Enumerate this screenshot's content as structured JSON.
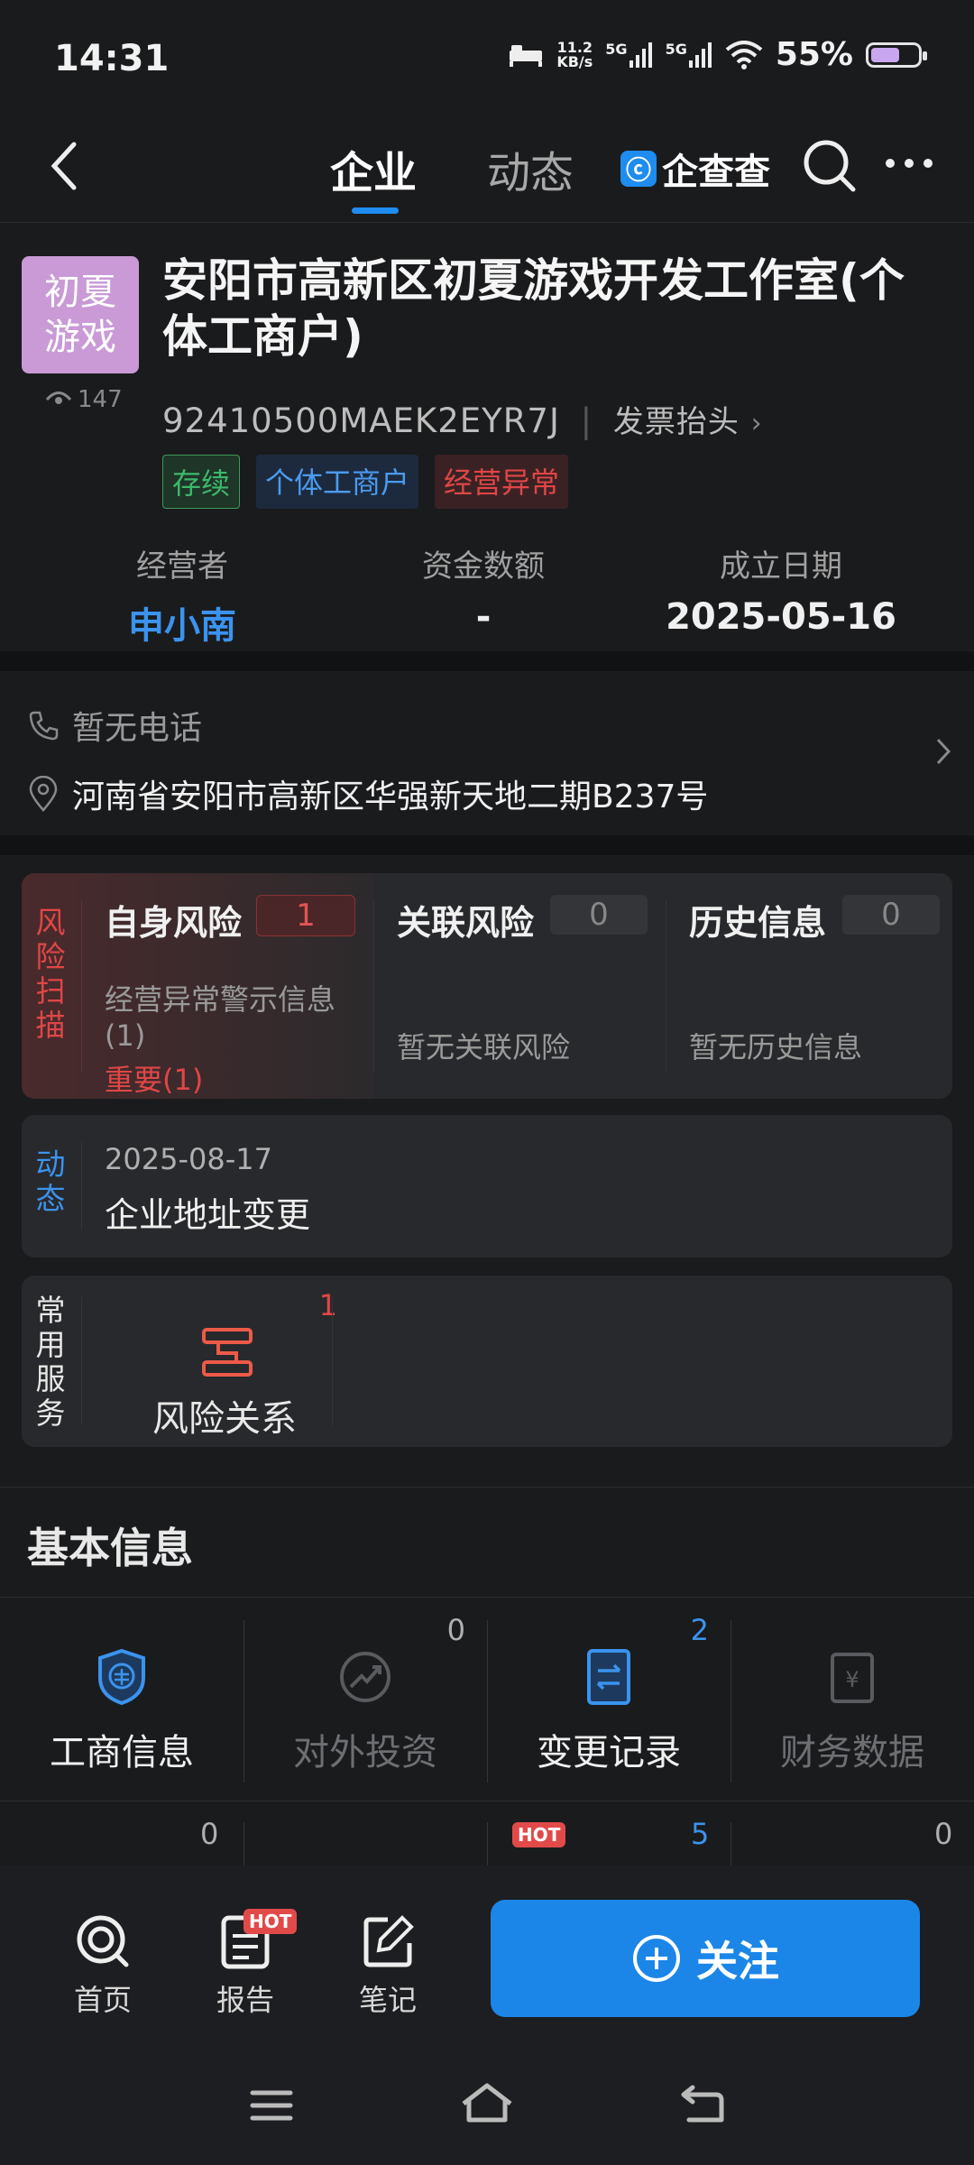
{
  "status_bar": {
    "time": "14:31",
    "net_speed_top": "11.2",
    "net_speed_bottom": "KB/s",
    "sig1": "5G",
    "sig2": "5G",
    "battery": "55%",
    "battery_level": 0.55
  },
  "nav": {
    "tabs": [
      "企业",
      "动态"
    ],
    "brand": "企查查"
  },
  "company": {
    "logo_text_1": "初夏",
    "logo_text_2": "游戏",
    "views": "147",
    "name": "安阳市高新区初夏游戏开发工作室(个体工商户)",
    "credit_code": "92410500MAEK2EYR7J",
    "invoice_label": "发票抬头",
    "tags": [
      "存续",
      "个体工商户",
      "经营异常"
    ],
    "facts": [
      {
        "label": "经营者",
        "value": "申小南"
      },
      {
        "label": "资金数额",
        "value": "-"
      },
      {
        "label": "成立日期",
        "value": "2025-05-16"
      }
    ]
  },
  "contact": {
    "phone": "暂无电话",
    "address": "河南省安阳市高新区华强新天地二期B237号"
  },
  "risk": {
    "label": [
      "风",
      "险",
      "扫",
      "描"
    ],
    "self": {
      "title": "自身风险",
      "count": "1",
      "line1": "经营异常警示信息",
      "line2": "(1)",
      "important": "重要(1)"
    },
    "related": {
      "title": "关联风险",
      "count": "0",
      "desc": "暂无关联风险"
    },
    "history": {
      "title": "历史信息",
      "count": "0",
      "desc": "暂无历史信息"
    }
  },
  "dynamic": {
    "label": [
      "动",
      "态"
    ],
    "date": "2025-08-17",
    "text": "企业地址变更"
  },
  "services": {
    "label": [
      "常",
      "用",
      "服",
      "务"
    ],
    "item": "风险关系",
    "count": "1"
  },
  "basic": {
    "title": "基本信息",
    "cells": [
      {
        "name": "工商信息",
        "count": ""
      },
      {
        "name": "对外投资",
        "count": "0"
      },
      {
        "name": "变更记录",
        "count": "2"
      },
      {
        "name": "财务数据",
        "count": ""
      }
    ],
    "row2_counts": [
      "0",
      "",
      "5",
      "0"
    ],
    "row2_hot": "HOT"
  },
  "bottom": {
    "home": "首页",
    "report": "报告",
    "notes": "笔记",
    "hot": "HOT",
    "follow": "关注"
  }
}
